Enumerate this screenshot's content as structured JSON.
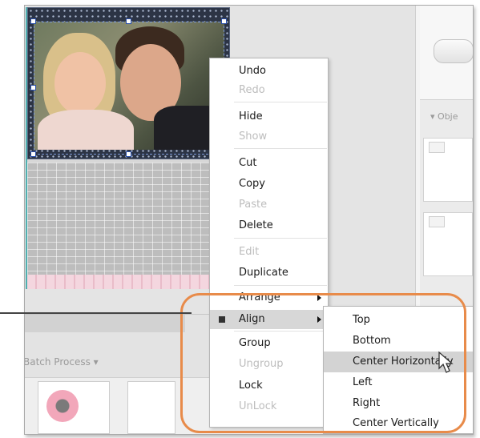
{
  "context_menu": {
    "items": [
      {
        "label": "Undo",
        "enabled": true
      },
      {
        "label": "Redo",
        "enabled": false
      },
      {
        "label": "Hide",
        "enabled": true
      },
      {
        "label": "Show",
        "enabled": false
      },
      {
        "label": "Cut",
        "enabled": true
      },
      {
        "label": "Copy",
        "enabled": true
      },
      {
        "label": "Paste",
        "enabled": false
      },
      {
        "label": "Delete",
        "enabled": true
      },
      {
        "label": "Edit",
        "enabled": false
      },
      {
        "label": "Duplicate",
        "enabled": true
      },
      {
        "label": "Arrange",
        "enabled": true,
        "submenu": true
      },
      {
        "label": "Align",
        "enabled": true,
        "submenu": true,
        "active": true
      },
      {
        "label": "Group",
        "enabled": true
      },
      {
        "label": "Ungroup",
        "enabled": false
      },
      {
        "label": "Lock",
        "enabled": true
      },
      {
        "label": "UnLock",
        "enabled": false
      }
    ]
  },
  "align_submenu": {
    "items": [
      {
        "label": "Top"
      },
      {
        "label": "Bottom"
      },
      {
        "label": "Center Horizontally",
        "hovered": true
      },
      {
        "label": "Left"
      },
      {
        "label": "Right"
      },
      {
        "label": "Center Vertically"
      }
    ]
  },
  "bottom_panel": {
    "batch_process_label": "Batch Process"
  },
  "right_panel": {
    "object_dropdown_label": "Obje"
  },
  "colors": {
    "highlight": "#e88b4a",
    "menu_hover": "#d3d3d3",
    "selection_handle": "#2a4fa8"
  },
  "icons": {
    "cursor": "pointer-cursor-icon",
    "submenu_arrow": "chevron-right-icon",
    "bullet": "square-bullet-icon"
  }
}
